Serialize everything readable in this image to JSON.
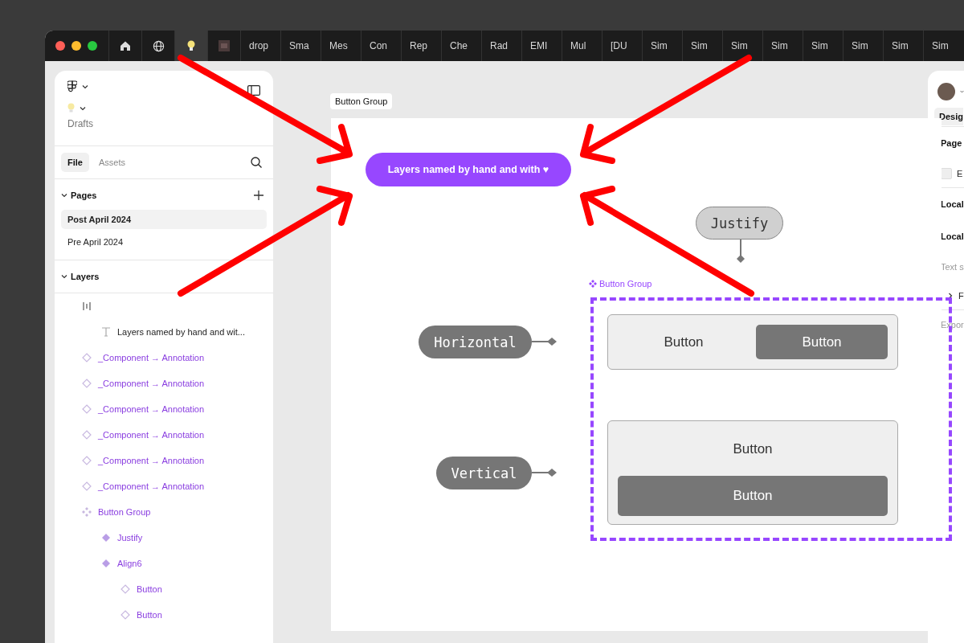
{
  "browser_tabs": [
    {
      "kind": "home",
      "selected": false
    },
    {
      "kind": "globe",
      "selected": false
    },
    {
      "kind": "bulb",
      "selected": true
    },
    {
      "kind": "thumbnail",
      "selected": false
    },
    {
      "kind": "text",
      "label": "drop",
      "selected": false
    },
    {
      "kind": "text",
      "label": "Sma",
      "selected": false
    },
    {
      "kind": "text",
      "label": "Mes",
      "selected": false
    },
    {
      "kind": "text",
      "label": "Con",
      "selected": false
    },
    {
      "kind": "text",
      "label": "Rep",
      "selected": false
    },
    {
      "kind": "text",
      "label": "Che",
      "selected": false
    },
    {
      "kind": "text",
      "label": "Rad",
      "selected": false
    },
    {
      "kind": "text",
      "label": "EMI",
      "selected": false
    },
    {
      "kind": "text",
      "label": "Mul",
      "selected": false
    },
    {
      "kind": "text",
      "label": "[DU",
      "selected": false
    },
    {
      "kind": "text",
      "label": "Sim",
      "selected": false
    },
    {
      "kind": "text",
      "label": "Sim",
      "selected": false
    },
    {
      "kind": "text",
      "label": "Sim",
      "selected": false
    },
    {
      "kind": "text",
      "label": "Sim",
      "selected": false
    },
    {
      "kind": "text",
      "label": "Sim",
      "selected": false
    },
    {
      "kind": "text",
      "label": "Sim",
      "selected": false
    },
    {
      "kind": "text",
      "label": "Sim",
      "selected": false
    },
    {
      "kind": "text",
      "label": "Sim",
      "selected": false
    }
  ],
  "left_panel": {
    "project": "Drafts",
    "tabs": [
      {
        "label": "File",
        "selected": true
      },
      {
        "label": "Assets",
        "selected": false
      }
    ],
    "pages": {
      "title": "Pages",
      "expanded": true,
      "items": [
        {
          "label": "Post April 2024",
          "selected": true
        },
        {
          "label": "Pre April 2024",
          "selected": false
        }
      ]
    },
    "layers": {
      "title": "Layers",
      "expanded": true,
      "items": [
        {
          "kind": "autolayout",
          "children": [
            {
              "kind": "text",
              "label": "Layers named by hand and wit..."
            }
          ]
        },
        {
          "kind": "instance",
          "label": "_Component → Annotation"
        },
        {
          "kind": "instance",
          "label": "_Component → Annotation"
        },
        {
          "kind": "instance",
          "label": "_Component → Annotation"
        },
        {
          "kind": "instance",
          "label": "_Component → Annotation"
        },
        {
          "kind": "instance",
          "label": "_Component → Annotation"
        },
        {
          "kind": "instance",
          "label": "_Component → Annotation"
        },
        {
          "kind": "component-set",
          "label": "Button Group",
          "children": [
            {
              "kind": "variant",
              "label": "Justify"
            },
            {
              "kind": "variant",
              "label": "Align6",
              "children": [
                {
                  "kind": "instance",
                  "label": "Button"
                },
                {
                  "kind": "instance",
                  "label": "Button"
                }
              ]
            }
          ]
        }
      ]
    }
  },
  "canvas": {
    "frame_label": "Button Group",
    "annotation": "Layers named by hand and with ♥",
    "component_label": "Button Group",
    "pills": [
      {
        "label": "Justify",
        "kind": "light"
      },
      {
        "label": "Horizontal",
        "kind": "dark"
      },
      {
        "label": "Vertical",
        "kind": "dark"
      }
    ],
    "horizontal_buttons": [
      {
        "label": "Button",
        "primary": false
      },
      {
        "label": "Button",
        "primary": true
      }
    ],
    "vertical_buttons": [
      {
        "label": "Button",
        "primary": false
      },
      {
        "label": "Button",
        "primary": true
      }
    ]
  },
  "right_panel": {
    "items": [
      {
        "kind": "tab",
        "label": "Desig"
      },
      {
        "kind": "heading",
        "label": "Page"
      },
      {
        "kind": "swatch",
        "label": "E"
      },
      {
        "kind": "heading",
        "label": "Local"
      },
      {
        "kind": "heading",
        "label": "Local"
      },
      {
        "kind": "muted",
        "label": "Text s"
      },
      {
        "kind": "tree",
        "label": "F"
      },
      {
        "kind": "muted",
        "label": "Expor"
      }
    ]
  }
}
